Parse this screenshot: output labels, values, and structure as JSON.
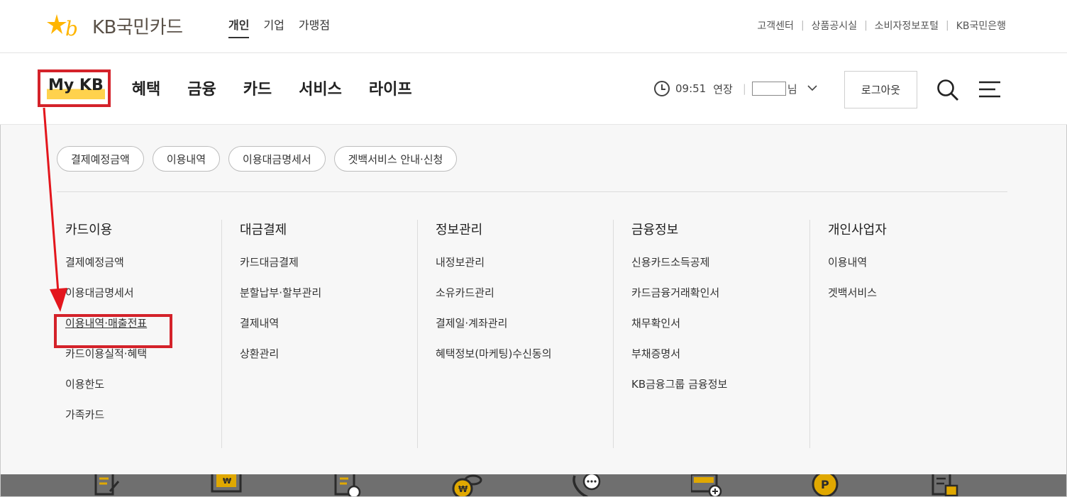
{
  "brand": {
    "logo_text": "KB국민카드",
    "accent": "#ffb500",
    "highlight": "#d4222a"
  },
  "segments": [
    {
      "label": "개인",
      "active": true
    },
    {
      "label": "기업",
      "active": false
    },
    {
      "label": "가맹점",
      "active": false
    }
  ],
  "utility_links": [
    "고객센터",
    "상품공시실",
    "소비자정보포털",
    "KB국민은행"
  ],
  "nav": {
    "items": [
      "My KB",
      "혜택",
      "금융",
      "카드",
      "서비스",
      "라이프"
    ]
  },
  "session": {
    "time": "09:51",
    "extend_label": "연장",
    "name_suffix": "님"
  },
  "logout_label": "로그아웃",
  "quick_chips": [
    "결제예정금액",
    "이용내역",
    "이용대금명세서",
    "겟백서비스 안내·신청"
  ],
  "menu_columns": [
    {
      "title": "카드이용",
      "items": [
        "결제예정금액",
        "이용대금명세서",
        "이용내역·매출전표",
        "카드이용실적·혜택",
        "이용한도",
        "가족카드"
      ]
    },
    {
      "title": "대금결제",
      "items": [
        "카드대금결제",
        "분할납부·할부관리",
        "결제내역",
        "상환관리"
      ]
    },
    {
      "title": "정보관리",
      "items": [
        "내정보관리",
        "소유카드관리",
        "결제일·계좌관리",
        "혜택정보(마케팅)수신동의"
      ]
    },
    {
      "title": "금융정보",
      "items": [
        "신용카드소득공제",
        "카드금융거래확인서",
        "채무확인서",
        "부채증명서",
        "KB금융그룹 금융정보"
      ]
    },
    {
      "title": "개인사업자",
      "items": [
        "이용내역",
        "겟백서비스"
      ]
    }
  ],
  "bottom_icons": [
    "document-edit-icon",
    "won-monitor-icon",
    "document-check-icon",
    "won-coin-icon",
    "phone-chat-icon",
    "card-add-icon",
    "point-icon",
    "document-lock-icon"
  ]
}
